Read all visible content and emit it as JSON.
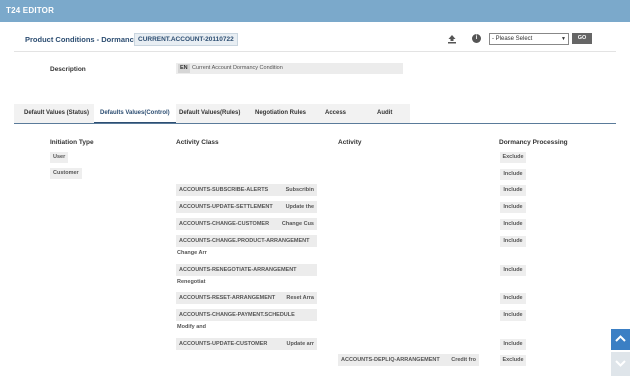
{
  "header": {
    "title": "T24 EDITOR"
  },
  "product": {
    "title": "Product Conditions - Dormancy",
    "id": "CURRENT.ACCOUNT-20110722"
  },
  "toolbar": {
    "select_value": "- Please Select",
    "go_label": "GO"
  },
  "description": {
    "label": "Description",
    "lang": "EN",
    "value": "Current Account Dormancy Condition"
  },
  "tabs": [
    "Default Values (Status)",
    "Defaults Values(Control)",
    "Default Values(Rules)",
    "Negotiation Rules",
    "Access",
    "Audit"
  ],
  "columns": [
    "Initiation Type",
    "Activity Class",
    "Activity",
    "Dormancy Processing"
  ],
  "initiation_types": [
    "User",
    "Customer"
  ],
  "rows": [
    {
      "cls": "ACCOUNTS-SUBSCRIBE-ALERTS",
      "act": "Subscribin",
      "processing": "Include"
    },
    {
      "cls": "ACCOUNTS-UPDATE-SETTLEMENT",
      "act": "Update the",
      "processing": "Include"
    },
    {
      "cls": "ACCOUNTS-CHANGE-CUSTOMER",
      "act": "Change Cus",
      "processing": "Include"
    },
    {
      "cls": "ACCOUNTS-CHANGE.PRODUCT-ARRANGEMENT",
      "sub": "Change Arr",
      "processing": "Include"
    },
    {
      "cls": "ACCOUNTS-RENEGOTIATE-ARRANGEMENT",
      "sub": "Renegotiat",
      "processing": "Include"
    },
    {
      "cls": "ACCOUNTS-RESET-ARRANGEMENT",
      "act": "Reset Arra",
      "processing": "Include"
    },
    {
      "cls": "ACCOUNTS-CHANGE-PAYMENT.SCHEDULE",
      "sub": "Modify and",
      "processing": "Include"
    },
    {
      "cls": "ACCOUNTS-UPDATE-CUSTOMER",
      "act": "Update arr",
      "processing": "Include"
    },
    {
      "cls": "ACCOUNTS-DEPLIQ-ARRANGEMENT",
      "act": "Credit fro",
      "processing": "Exclude"
    }
  ],
  "processing_top": [
    "Exclude",
    "Include"
  ],
  "icons": {
    "upload": "upload-icon",
    "info": "info-icon",
    "scroll_up": "chevron-up-icon",
    "scroll_down": "chevron-down-icon"
  },
  "colors": {
    "topbar": "#7ba9cb",
    "accent": "#2d4e72",
    "scroll_button": "#3b7fc4"
  }
}
